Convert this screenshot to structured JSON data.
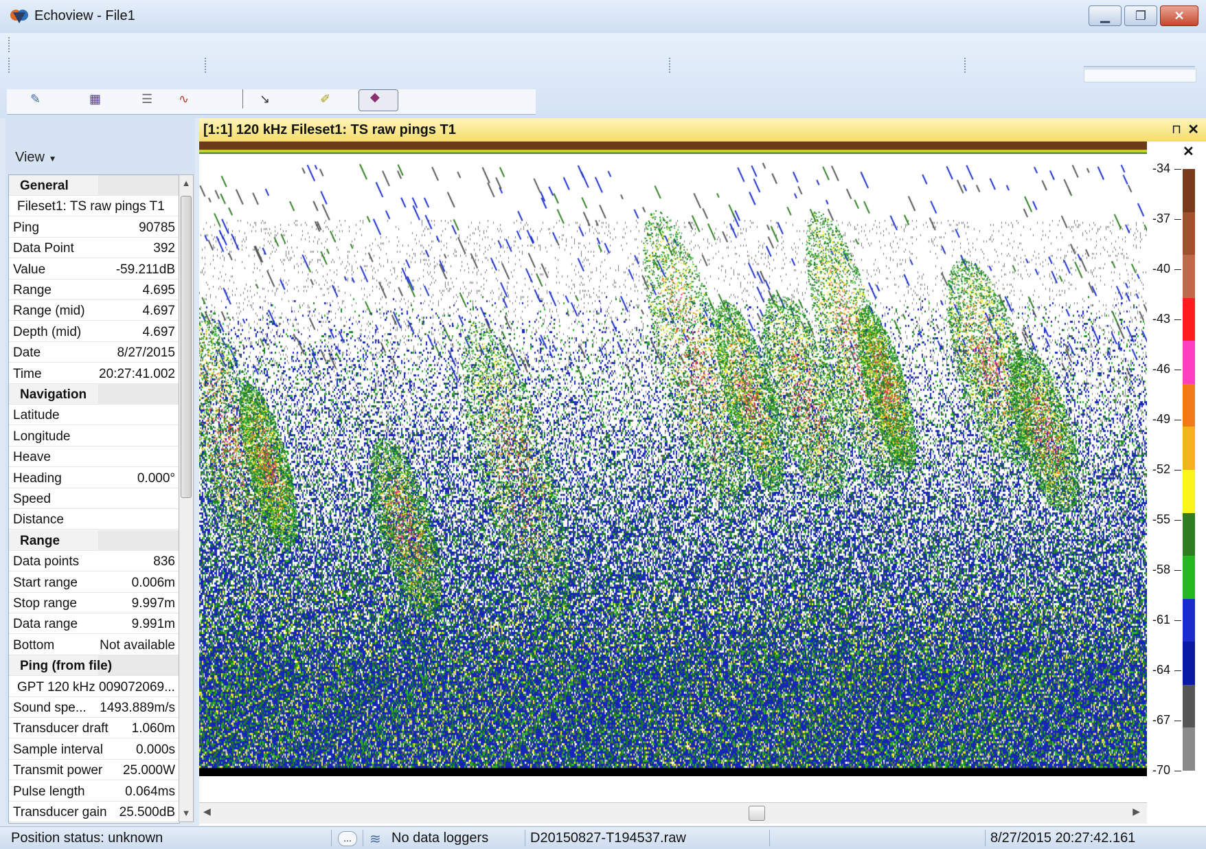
{
  "window": {
    "title": "Echoview - File1"
  },
  "echogram": {
    "title": "[1:1] 120 kHz Fileset1: TS raw pings T1"
  },
  "colorbar": {
    "ticks": [
      "-34",
      "-37",
      "-40",
      "-43",
      "-46",
      "-49",
      "-52",
      "-55",
      "-58",
      "-61",
      "-64",
      "-67",
      "-70"
    ],
    "colors": [
      "#7a3b1d",
      "#a3512c",
      "#c0694a",
      "#ff1e1e",
      "#ff3ec0",
      "#f17a1a",
      "#f4b21f",
      "#fbf41a",
      "#2e7d20",
      "#23b81e",
      "#1a2ccc",
      "#0b1aa2",
      "#555555",
      "#8a8a8a"
    ]
  },
  "sidebar": {
    "view_label": "View",
    "properties": [
      {
        "type": "section",
        "key": "General"
      },
      {
        "type": "sub",
        "key": "Fileset1: TS raw pings T1"
      },
      {
        "type": "row",
        "key": "Ping",
        "value": "90785"
      },
      {
        "type": "row",
        "key": "Data Point",
        "value": "392"
      },
      {
        "type": "row",
        "key": "Value",
        "value": "-59.211dB"
      },
      {
        "type": "row",
        "key": "Range",
        "value": "4.695"
      },
      {
        "type": "row",
        "key": "Range (mid)",
        "value": "4.697"
      },
      {
        "type": "row",
        "key": "Depth (mid)",
        "value": "4.697"
      },
      {
        "type": "row",
        "key": "Date",
        "value": "8/27/2015"
      },
      {
        "type": "row",
        "key": "Time",
        "value": "20:27:41.002"
      },
      {
        "type": "section",
        "key": "Navigation"
      },
      {
        "type": "row",
        "key": "Latitude",
        "value": ""
      },
      {
        "type": "row",
        "key": "Longitude",
        "value": ""
      },
      {
        "type": "row",
        "key": "Heave",
        "value": ""
      },
      {
        "type": "row",
        "key": "Heading",
        "value": "0.000°"
      },
      {
        "type": "row",
        "key": "Speed",
        "value": ""
      },
      {
        "type": "row",
        "key": "Distance",
        "value": ""
      },
      {
        "type": "section",
        "key": "Range"
      },
      {
        "type": "row",
        "key": "Data points",
        "value": "836"
      },
      {
        "type": "row",
        "key": "Start range",
        "value": "0.006m"
      },
      {
        "type": "row",
        "key": "Stop range",
        "value": "9.997m"
      },
      {
        "type": "row",
        "key": "Data range",
        "value": "9.991m"
      },
      {
        "type": "row",
        "key": "Bottom",
        "value": "Not available"
      },
      {
        "type": "section",
        "key": "Ping (from file)"
      },
      {
        "type": "sub",
        "key": "GPT 120 kHz 009072069..."
      },
      {
        "type": "row",
        "key": "Sound spe...",
        "value": "1493.889m/s"
      },
      {
        "type": "row",
        "key": "Transducer draft",
        "value": "1.060m"
      },
      {
        "type": "row",
        "key": "Sample interval",
        "value": "0.000s"
      },
      {
        "type": "row",
        "key": "Transmit power",
        "value": "25.000W"
      },
      {
        "type": "row",
        "key": "Pulse length",
        "value": "0.064ms"
      },
      {
        "type": "row",
        "key": "Transducer gain",
        "value": "25.500dB"
      }
    ]
  },
  "statusbar": {
    "position": "Position status: unknown",
    "dots": "...",
    "loggers": "No data loggers",
    "file": "D20150827-T194537.raw",
    "datetime": "8/27/2015 20:27:42.161"
  },
  "icons": {
    "app": "echoview-logo-icon",
    "minimize": "minimize-icon",
    "maximize": "restore-icon",
    "close": "close-icon",
    "pin": "pin-icon",
    "loggers": "data-logger-icon"
  }
}
